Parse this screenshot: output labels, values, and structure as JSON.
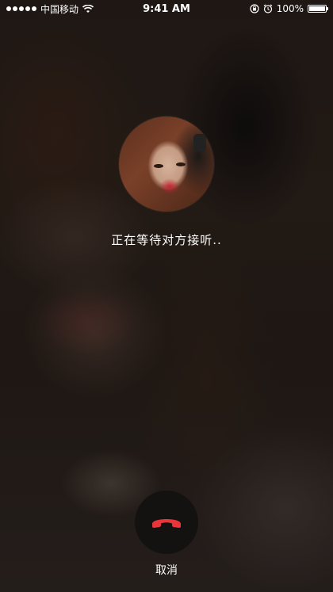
{
  "status_bar": {
    "carrier": "中国移动",
    "time": "9:41 AM",
    "battery_percent": "100%",
    "battery_level": 1.0,
    "icons": [
      "signal-dots-icon",
      "wifi-icon",
      "orientation-lock-icon",
      "alarm-icon",
      "battery-icon"
    ]
  },
  "call": {
    "status_text": "正在等待对方接听..",
    "cancel_label": "取消",
    "hangup_icon": "phone-hangup-icon",
    "hangup_icon_color": "#e8353a"
  },
  "colors": {
    "text": "#ffffff",
    "button_bg": "#141211"
  }
}
